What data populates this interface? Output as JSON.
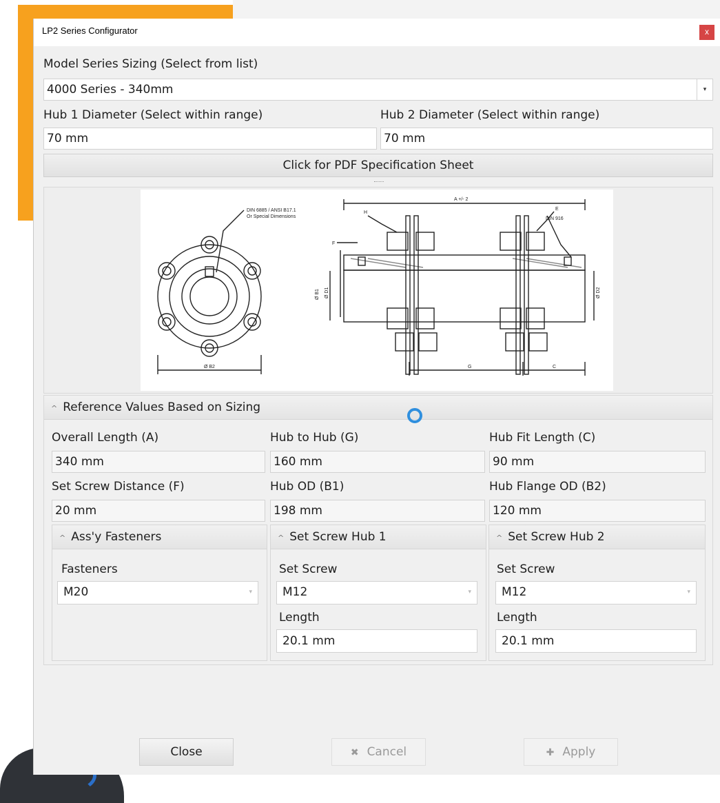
{
  "window": {
    "title": "LP2 Series Configurator",
    "close_glyph": "x"
  },
  "model": {
    "label": "Model Series Sizing (Select from list)",
    "value": "4000 Series - 340mm"
  },
  "hub1": {
    "label": "Hub 1 Diameter (Select within range)",
    "value": "70 mm"
  },
  "hub2": {
    "label": "Hub 2 Diameter (Select within range)",
    "value": "70 mm"
  },
  "pdf_button": "Click for PDF Specification Sheet",
  "drawing": {
    "note_line1": "DIN 6885 / ANSI B17.1",
    "note_line2": "Or Special Dimensions",
    "dim_a": "A +/- 2",
    "label_h": "H",
    "label_e": "E",
    "din916": "DIN 916",
    "label_f": "F",
    "label_g": "G",
    "label_c": "C",
    "label_b2": "Ø B2",
    "label_b1": "Ø B1",
    "label_d1": "Ø D1",
    "label_d2": "Ø D2"
  },
  "reference": {
    "header": "Reference Values Based on Sizing",
    "overall_length": {
      "label": "Overall Length (A)",
      "value": "340 mm"
    },
    "hub_to_hub": {
      "label": "Hub to Hub (G)",
      "value": "160 mm"
    },
    "hub_fit_length": {
      "label": "Hub Fit Length (C)",
      "value": "90 mm"
    },
    "set_screw_distance": {
      "label": "Set Screw Distance (F)",
      "value": "20 mm"
    },
    "hub_od": {
      "label": "Hub OD (B1)",
      "value": "198 mm"
    },
    "hub_flange_od": {
      "label": "Hub Flange OD (B2)",
      "value": "120 mm"
    }
  },
  "fasteners": {
    "header": "Ass'y Fasteners",
    "label": "Fasteners",
    "value": "M20"
  },
  "set_screw_hub1": {
    "header": "Set Screw Hub 1",
    "screw_label": "Set Screw",
    "screw_value": "M12",
    "length_label": "Length",
    "length_value": "20.1 mm"
  },
  "set_screw_hub2": {
    "header": "Set Screw Hub 2",
    "screw_label": "Set Screw",
    "screw_value": "M12",
    "length_label": "Length",
    "length_value": "20.1 mm"
  },
  "buttons": {
    "close": "Close",
    "cancel": "Cancel",
    "cancel_icon": "✖",
    "apply": "Apply",
    "apply_icon": "✚"
  },
  "colors": {
    "accent_orange": "#f7a11e",
    "close_red": "#d64545",
    "spinner_blue": "#2f8fde"
  }
}
